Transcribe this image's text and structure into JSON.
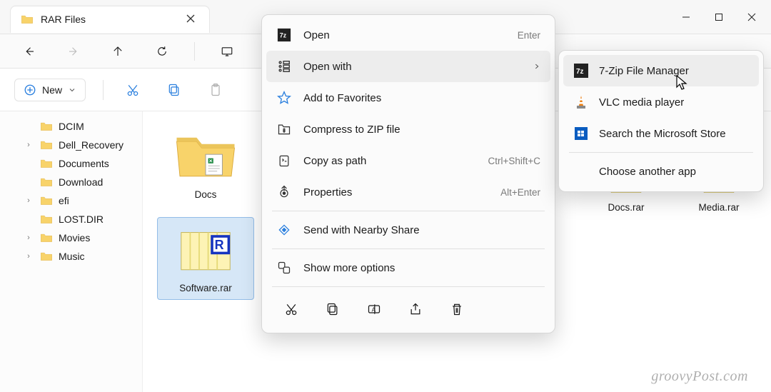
{
  "tab": {
    "title": "RAR Files"
  },
  "toolbar": {
    "new_label": "New"
  },
  "sidebar": [
    {
      "label": "DCIM",
      "chev": false,
      "indent": true
    },
    {
      "label": "Dell_Recovery",
      "chev": true,
      "indent": true
    },
    {
      "label": "Documents",
      "chev": false,
      "indent": true
    },
    {
      "label": "Download",
      "chev": false,
      "indent": true
    },
    {
      "label": "efi",
      "chev": true,
      "indent": true
    },
    {
      "label": "LOST.DIR",
      "chev": false,
      "indent": true
    },
    {
      "label": "Movies",
      "chev": true,
      "indent": true
    },
    {
      "label": "Music",
      "chev": true,
      "indent": true
    }
  ],
  "folder_item": {
    "label": "Docs"
  },
  "rar_items_right": [
    {
      "label": "Docs.rar"
    },
    {
      "label": "Media.rar"
    }
  ],
  "selected_item": {
    "label": "Software.rar"
  },
  "context_menu": {
    "open": "Open",
    "open_shortcut": "Enter",
    "open_with": "Open with",
    "add_favorites": "Add to Favorites",
    "compress": "Compress to ZIP file",
    "copy_path": "Copy as path",
    "copy_path_shortcut": "Ctrl+Shift+C",
    "properties": "Properties",
    "properties_shortcut": "Alt+Enter",
    "nearby_share": "Send with Nearby Share",
    "show_more": "Show more options"
  },
  "submenu": {
    "seven_zip": "7-Zip File Manager",
    "vlc": "VLC media player",
    "store": "Search the Microsoft Store",
    "choose": "Choose another app"
  },
  "watermark": "groovyPost.com"
}
